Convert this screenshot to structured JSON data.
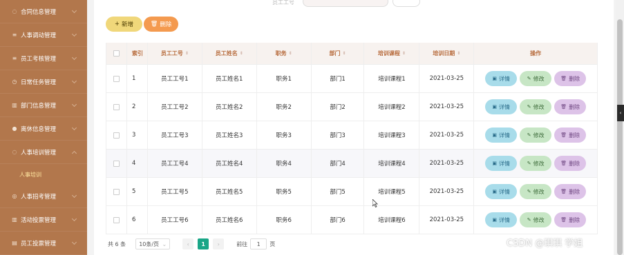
{
  "sidebar": {
    "items": [
      {
        "label": "合同信息管理",
        "icon": "chat-icon"
      },
      {
        "label": "人事调动管理",
        "icon": "list-icon"
      },
      {
        "label": "员工考核管理",
        "icon": "list-icon"
      },
      {
        "label": "日常任务管理",
        "icon": "clock-icon"
      },
      {
        "label": "部门信息管理",
        "icon": "chart-icon"
      },
      {
        "label": "离休信息管理",
        "icon": "location-icon"
      },
      {
        "label": "人事培训管理",
        "icon": "chat-icon"
      },
      {
        "label": "人事招考管理",
        "icon": "compass-icon"
      },
      {
        "label": "活动投票管理",
        "icon": "chart-icon"
      },
      {
        "label": "员工投票管理",
        "icon": "doc-icon"
      }
    ],
    "sub_item": "人事培训"
  },
  "toolbar": {
    "add_label": "新增",
    "delete_label": "删除",
    "search_label_fragment": "员工工号"
  },
  "table": {
    "columns": {
      "index": "索引",
      "emp_no": "员工工号",
      "emp_name": "员工姓名",
      "job": "职务",
      "dept": "部门",
      "course": "培训课程",
      "date": "培训日期",
      "ops": "操作"
    },
    "actions": {
      "detail": "详情",
      "edit": "修改",
      "delete": "删除"
    },
    "rows": [
      {
        "index": "1",
        "emp_no": "员工工号1",
        "emp_name": "员工姓名1",
        "job": "职务1",
        "dept": "部门1",
        "course": "培训课程1",
        "date": "2021-03-25"
      },
      {
        "index": "2",
        "emp_no": "员工工号2",
        "emp_name": "员工姓名2",
        "job": "职务2",
        "dept": "部门2",
        "course": "培训课程2",
        "date": "2021-03-25"
      },
      {
        "index": "3",
        "emp_no": "员工工号3",
        "emp_name": "员工姓名3",
        "job": "职务3",
        "dept": "部门3",
        "course": "培训课程3",
        "date": "2021-03-25"
      },
      {
        "index": "4",
        "emp_no": "员工工号4",
        "emp_name": "员工姓名4",
        "job": "职务4",
        "dept": "部门4",
        "course": "培训课程4",
        "date": "2021-03-25"
      },
      {
        "index": "5",
        "emp_no": "员工工号5",
        "emp_name": "员工姓名5",
        "job": "职务5",
        "dept": "部门5",
        "course": "培训课程5",
        "date": "2021-03-25"
      },
      {
        "index": "6",
        "emp_no": "员工工号6",
        "emp_name": "员工姓名6",
        "job": "职务6",
        "dept": "部门6",
        "course": "培训课程6",
        "date": "2021-03-25"
      }
    ]
  },
  "pagination": {
    "total": "共 6 条",
    "page_size": "10条/页",
    "current_page": "1",
    "goto_label": "前往",
    "goto_value": "1",
    "page_unit": "页"
  },
  "watermark": "CSDN @琪琪 学姐",
  "colors": {
    "sidebar": "#b2774c",
    "accent": "#1aa687",
    "add": "#f0d77a",
    "delete": "#f49a4f"
  }
}
